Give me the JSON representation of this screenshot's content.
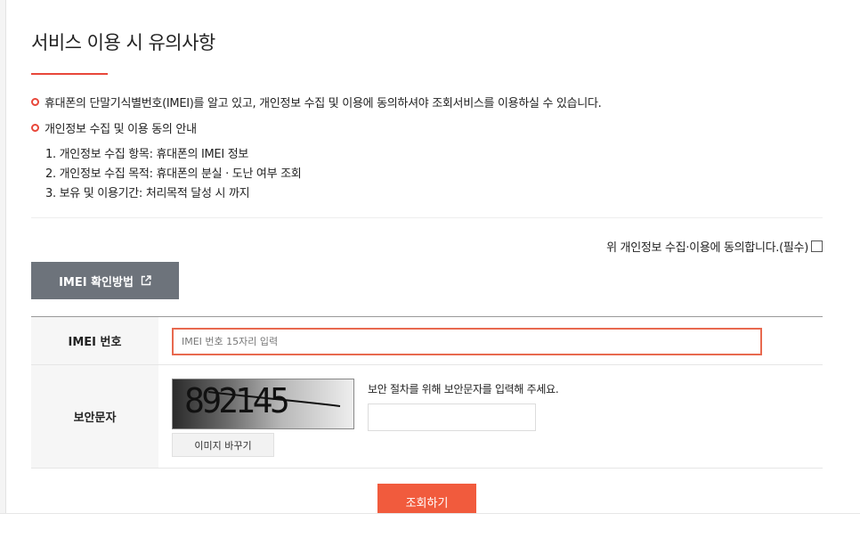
{
  "title": "서비스 이용 시 유의사항",
  "notices": [
    "휴대폰의 단말기식별번호(IMEI)를 알고 있고, 개인정보 수집 및 이용에 동의하셔야 조회서비스를 이용하실 수 있습니다.",
    "개인정보 수집 및 이용 동의 안내"
  ],
  "info_items": [
    "1. 개인정보 수집 항목: 휴대폰의 IMEI 정보",
    "2. 개인정보 수집 목적: 휴대폰의 분실 · 도난 여부 조회",
    "3. 보유 및 이용기간: 처리목적 달성 시 까지"
  ],
  "agree_label": "위 개인정보 수집·이용에 동의합니다.(필수)",
  "imei_guide_label": "IMEI 확인방법",
  "form": {
    "imei_label": "IMEI 번호",
    "imei_placeholder": "IMEI 번호 15자리 입력",
    "captcha_label": "보안문자",
    "captcha_text": "892145",
    "captcha_refresh_label": "이미지 바꾸기",
    "captcha_hint": "보안 절차를 위해 보안문자를 입력해 주세요."
  },
  "submit_label": "조회하기",
  "colors": {
    "accent": "#e8473a",
    "button_gray": "#6d737b",
    "submit": "#f15b3d"
  }
}
